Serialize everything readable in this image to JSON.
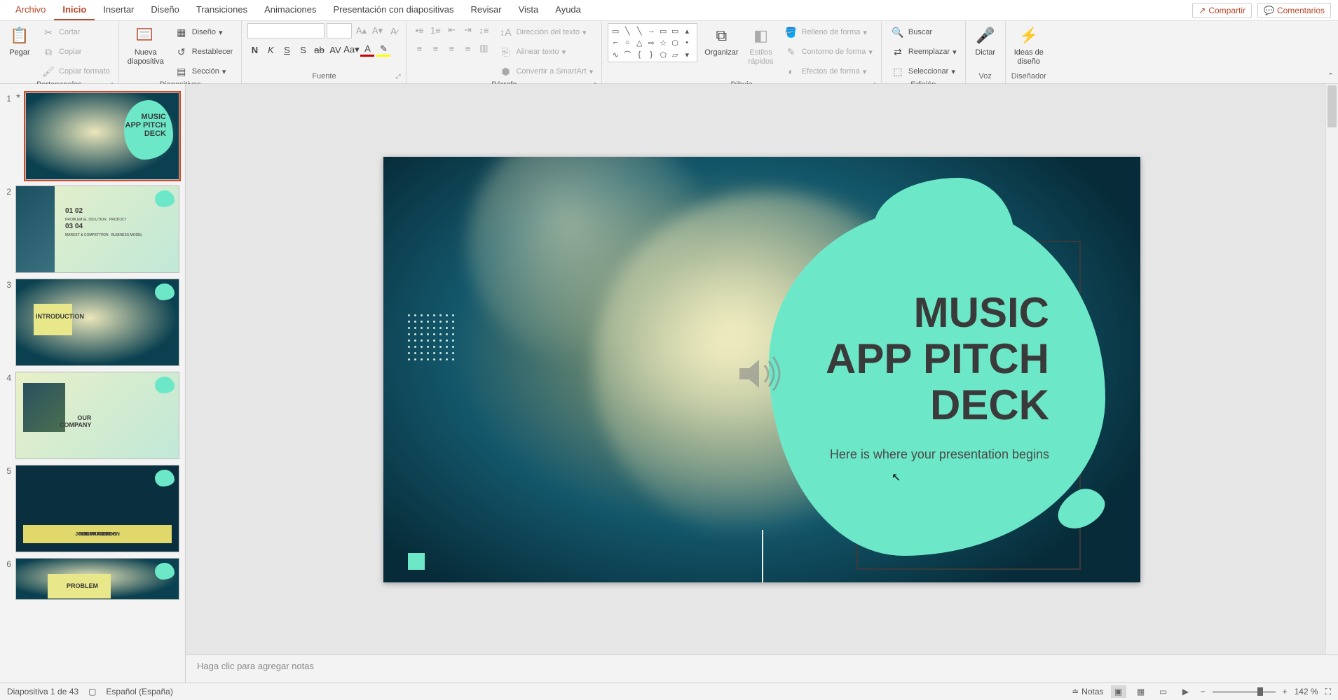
{
  "menubar": {
    "items": [
      "Archivo",
      "Inicio",
      "Insertar",
      "Diseño",
      "Transiciones",
      "Animaciones",
      "Presentación con diapositivas",
      "Revisar",
      "Vista",
      "Ayuda"
    ],
    "active": "Inicio",
    "share": "Compartir",
    "comments": "Comentarios"
  },
  "ribbon": {
    "clipboard": {
      "label": "Portapapeles",
      "paste": "Pegar",
      "cut": "Cortar",
      "copy": "Copiar",
      "format_painter": "Copiar formato"
    },
    "slides": {
      "label": "Diapositivas",
      "new_slide": "Nueva\ndiapositiva",
      "layout": "Diseño",
      "reset": "Restablecer",
      "section": "Sección"
    },
    "font": {
      "label": "Fuente",
      "family": "",
      "size": ""
    },
    "paragraph": {
      "label": "Párrafo",
      "text_direction": "Dirección del texto",
      "align_text": "Alinear texto",
      "smartart": "Convertir a SmartArt"
    },
    "drawing": {
      "label": "Dibujo",
      "arrange": "Organizar",
      "quick_styles": "Estilos\nrápidos",
      "shape_fill": "Relleno de forma",
      "shape_outline": "Contorno de forma",
      "shape_effects": "Efectos de forma"
    },
    "editing": {
      "label": "Edición",
      "find": "Buscar",
      "replace": "Reemplazar",
      "select": "Seleccionar"
    },
    "voice": {
      "label": "Voz",
      "dictate": "Dictar"
    },
    "designer": {
      "label": "Diseñador",
      "design_ideas": "Ideas de\ndiseño"
    }
  },
  "slides_panel": {
    "thumbs": [
      {
        "num": "1",
        "title": "MUSIC APP PITCH DECK"
      },
      {
        "num": "2",
        "title": "01 02 03 04"
      },
      {
        "num": "3",
        "title": "INTRODUCTION"
      },
      {
        "num": "4",
        "title": "OUR COMPANY"
      },
      {
        "num": "5",
        "title": "TEAM"
      },
      {
        "num": "6",
        "title": "PROBLEM"
      }
    ]
  },
  "slide": {
    "title_line1": "MUSIC",
    "title_line2": "APP PITCH",
    "title_line3": "DECK",
    "subtitle": "Here is where your presentation begins"
  },
  "notes": {
    "placeholder": "Haga clic para agregar notas"
  },
  "status": {
    "slide_counter": "Diapositiva 1 de 43",
    "language": "Español (España)",
    "notes_btn": "Notas",
    "zoom": "142 %"
  },
  "colors": {
    "accent": "#b7472a",
    "mint": "#6ce8c8",
    "slide_bg_dark": "#0a3a4a"
  }
}
